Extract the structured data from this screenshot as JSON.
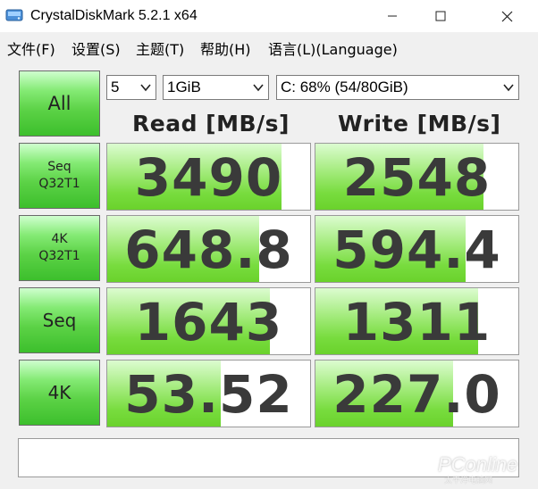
{
  "window": {
    "title": "CrystalDiskMark 5.2.1 x64",
    "app_icon": "disk-icon",
    "controls": [
      "minimize-icon",
      "maximize-icon",
      "close-icon"
    ]
  },
  "menu": {
    "items": [
      "文件(F)",
      "设置(S)",
      "主题(T)",
      "帮助(H)",
      "语言(L)(Language)"
    ]
  },
  "toolbar": {
    "all_label": "All",
    "count_value": "5",
    "size_value": "1GiB",
    "drive_value": "C: 68% (54/80GiB)"
  },
  "headers": {
    "read": "Read [MB/s]",
    "write": "Write [MB/s]"
  },
  "tests": [
    {
      "label": "Seq\nQ32T1",
      "read": "3490",
      "write": "2548",
      "read_fill": 0.86,
      "write_fill": 0.83
    },
    {
      "label": "4K\nQ32T1",
      "read": "648.8",
      "write": "594.4",
      "read_fill": 0.75,
      "write_fill": 0.74
    },
    {
      "label": "Seq",
      "read": "1643",
      "write": "1311",
      "read_fill": 0.8,
      "write_fill": 0.8
    },
    {
      "label": "4K",
      "read": "53.52",
      "write": "227.0",
      "read_fill": 0.56,
      "write_fill": 0.68
    }
  ],
  "comment": "",
  "watermark": {
    "brand": "PConline",
    "sub": "太平洋电脑网"
  },
  "colors": {
    "accent_green": "#6ad22c",
    "button_green": "#5cd246",
    "text": "#3a3a3a"
  }
}
